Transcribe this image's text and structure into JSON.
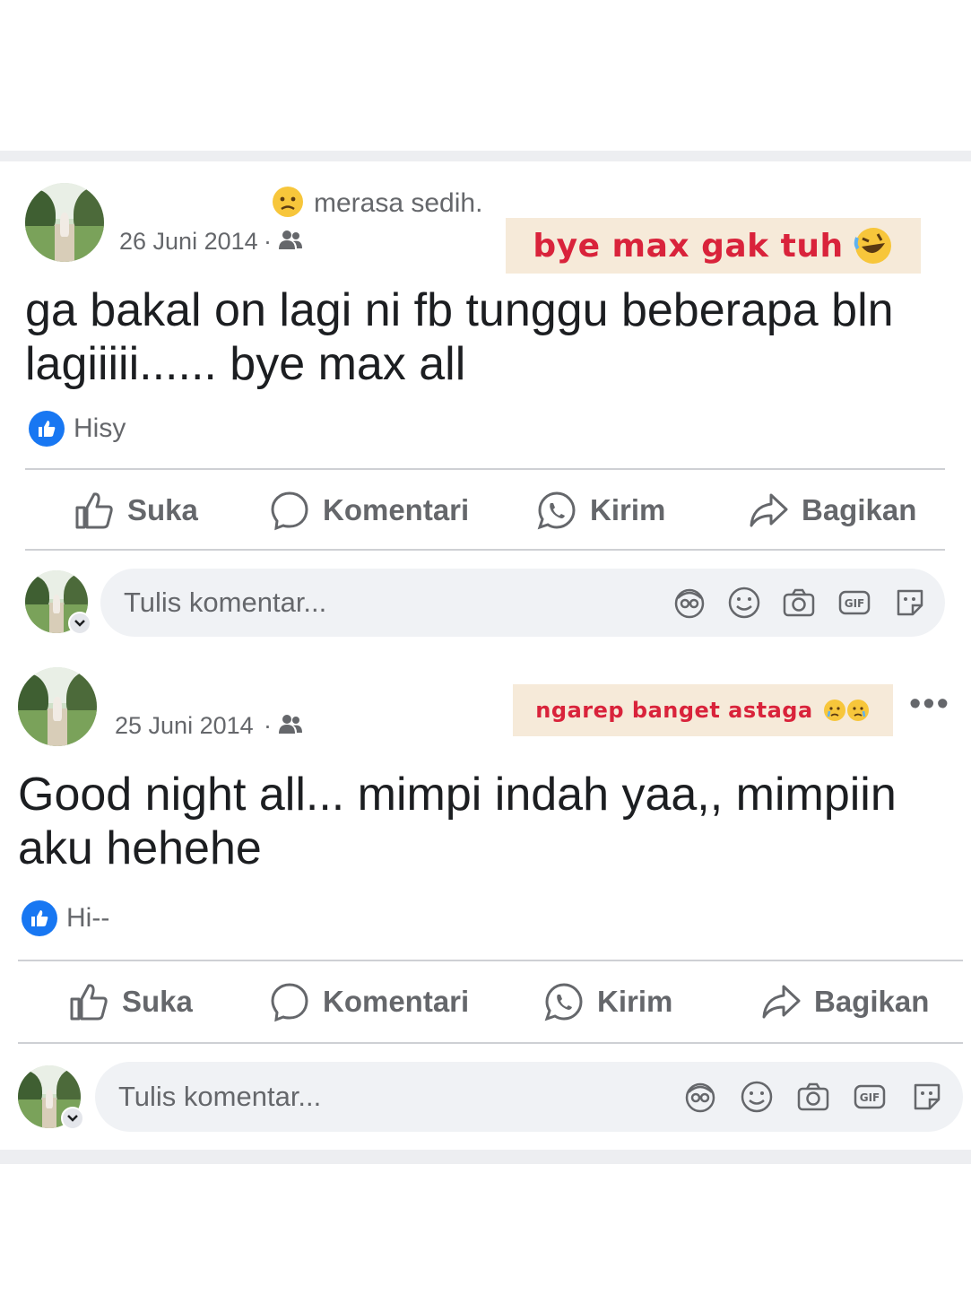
{
  "posts": [
    {
      "feeling": "merasa sedih.",
      "date": "26 Juni 2014",
      "separator": "·",
      "sticker": "bye max gak tuh",
      "text": "ga bakal on lagi ni fb tunggu beberapa bln lagiiiii...... bye max all",
      "reaction_name": "Hisy",
      "actions": {
        "like": "Suka",
        "comment": "Komentari",
        "send": "Kirim",
        "share": "Bagikan"
      },
      "comment_placeholder": "Tulis komentar..."
    },
    {
      "date": "25 Juni 2014",
      "separator": "·",
      "sticker": "ngarep banget astaga",
      "more": "•••",
      "text": "Good night all... mimpi indah yaa,, mimpiin aku hehehe",
      "reaction_name": "Hi--",
      "actions": {
        "like": "Suka",
        "comment": "Komentari",
        "send": "Kirim",
        "share": "Bagikan"
      },
      "comment_placeholder": "Tulis komentar..."
    }
  ],
  "icons": {
    "feeling": "sad-face-emoji-icon",
    "audience": "friends-icon",
    "like": "thumbs-up-icon",
    "comment": "comment-bubble-icon",
    "send": "whatsapp-icon",
    "share": "share-arrow-icon",
    "comment_tools": [
      "avatar-sticker-icon",
      "emoji-icon",
      "camera-icon",
      "gif-icon",
      "sticker-icon"
    ]
  },
  "colors": {
    "like_blue": "#1877f2",
    "sticker_text": "#d9233b",
    "sticker_bg": "#f6ead9",
    "secondary_text": "#65676b"
  }
}
